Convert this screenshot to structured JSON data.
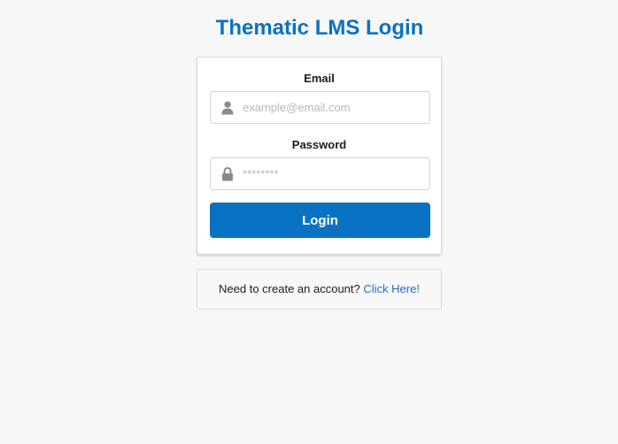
{
  "page": {
    "title": "Thematic LMS Login"
  },
  "form": {
    "email": {
      "label": "Email",
      "placeholder": "example@email.com",
      "icon": "user-icon"
    },
    "password": {
      "label": "Password",
      "placeholder": "********",
      "icon": "lock-icon"
    },
    "submit_label": "Login"
  },
  "signup": {
    "prompt": "Need to create an account?",
    "link_text": "Click Here!"
  },
  "colors": {
    "accent": "#0a72c2",
    "link": "#1e70bf",
    "background": "#f7f7f7"
  }
}
